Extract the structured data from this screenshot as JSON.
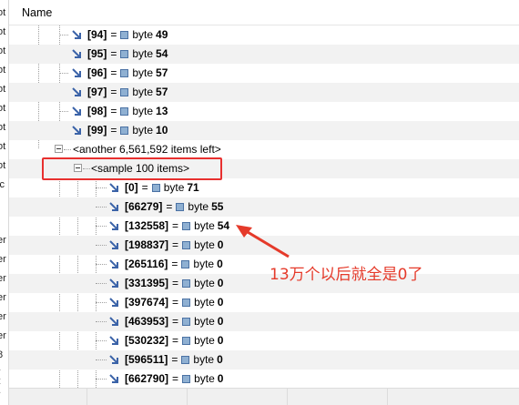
{
  "header": {
    "column_name": "Name"
  },
  "left_strip_fragments": [
    "ot",
    "ot",
    "ot",
    "ot",
    "ot",
    "ot",
    "ot",
    "ot",
    "ot",
    "ic",
    "er",
    "er",
    "er",
    "er",
    "er",
    "er",
    "8",
    "(",
    "("
  ],
  "rows": [
    {
      "index": "[94]",
      "eq": "=",
      "type": "byte",
      "value": "49"
    },
    {
      "index": "[95]",
      "eq": "=",
      "type": "byte",
      "value": "54"
    },
    {
      "index": "[96]",
      "eq": "=",
      "type": "byte",
      "value": "57"
    },
    {
      "index": "[97]",
      "eq": "=",
      "type": "byte",
      "value": "57"
    },
    {
      "index": "[98]",
      "eq": "=",
      "type": "byte",
      "value": "13"
    },
    {
      "index": "[99]",
      "eq": "=",
      "type": "byte",
      "value": "10"
    }
  ],
  "another_node": "<another 6,561,592 items left>",
  "sample_node": "<sample 100 items>",
  "sample_rows": [
    {
      "index": "[0]",
      "eq": "=",
      "type": "byte",
      "value": "71"
    },
    {
      "index": "[66279]",
      "eq": "=",
      "type": "byte",
      "value": "55"
    },
    {
      "index": "[132558]",
      "eq": "=",
      "type": "byte",
      "value": "54"
    },
    {
      "index": "[198837]",
      "eq": "=",
      "type": "byte",
      "value": "0"
    },
    {
      "index": "[265116]",
      "eq": "=",
      "type": "byte",
      "value": "0"
    },
    {
      "index": "[331395]",
      "eq": "=",
      "type": "byte",
      "value": "0"
    },
    {
      "index": "[397674]",
      "eq": "=",
      "type": "byte",
      "value": "0"
    },
    {
      "index": "[463953]",
      "eq": "=",
      "type": "byte",
      "value": "0"
    },
    {
      "index": "[530232]",
      "eq": "=",
      "type": "byte",
      "value": "0"
    },
    {
      "index": "[596511]",
      "eq": "=",
      "type": "byte",
      "value": "0"
    },
    {
      "index": "[662790]",
      "eq": "=",
      "type": "byte",
      "value": "0"
    }
  ],
  "annotation": {
    "text": "13万个以后就全是0了",
    "color": "#e53a2a"
  },
  "colors": {
    "highlight": "#e8302f",
    "arrow_icon": "#3b63a8",
    "row_alt": "#f2f2f2"
  }
}
